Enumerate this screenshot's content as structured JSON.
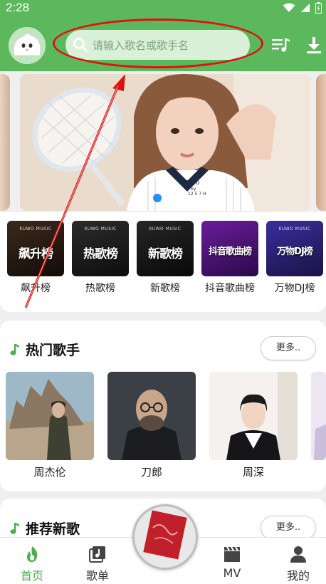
{
  "status_bar": {
    "time": "2:28",
    "icons": [
      "wifi-icon",
      "signal-icon",
      "battery-icon"
    ]
  },
  "header": {
    "logo": "mascot-logo",
    "search": {
      "placeholder": "请输入歌名或歌手名",
      "icon": "search-icon"
    },
    "actions": [
      "playlist-queue-icon",
      "download-icon"
    ]
  },
  "banner": {
    "dots": {
      "count": 2,
      "active_index": 0
    },
    "jersey_text": [
      "SS20",
      "by",
      "12 5 7 H"
    ]
  },
  "charts": [
    {
      "label": "飙升榜",
      "cover_title": "飙升榜",
      "cover_brand": "KUWO MUSIC",
      "bg": "#2a1c12"
    },
    {
      "label": "热歌榜",
      "cover_title": "热歌榜",
      "cover_brand": "KUWO MUSIC",
      "bg": "#1a1a1a"
    },
    {
      "label": "新歌榜",
      "cover_title": "新歌榜",
      "cover_brand": "KUWO MUSIC",
      "bg": "#161616"
    },
    {
      "label": "抖音歌曲榜",
      "cover_title": "抖音歌曲榜",
      "cover_brand": "",
      "bg": "#4a1670"
    },
    {
      "label": "万物DJ榜",
      "cover_title": "万物DJ榜",
      "cover_brand": "KUWO MUSIC",
      "bg": "#2d2378"
    }
  ],
  "hot_singers": {
    "title": "热门歌手",
    "more_label": "更多..",
    "items": [
      {
        "name": "周杰伦"
      },
      {
        "name": "刀郎"
      },
      {
        "name": "周深"
      }
    ]
  },
  "new_songs": {
    "title": "推荐新歌",
    "more_label": "更多.."
  },
  "bottom_nav": [
    {
      "label": "首页",
      "icon": "home-flame-icon",
      "active": true
    },
    {
      "label": "歌单",
      "icon": "playlist-icon",
      "active": false
    },
    {
      "label": "MV",
      "icon": "clapperboard-icon",
      "active": false
    },
    {
      "label": "我的",
      "icon": "user-icon",
      "active": false
    }
  ],
  "colors": {
    "brand_green": "#5cb85c",
    "search_bg": "#d9f0d9",
    "annotation_red": "#e01010",
    "active_dot": "#2a8ff0"
  }
}
